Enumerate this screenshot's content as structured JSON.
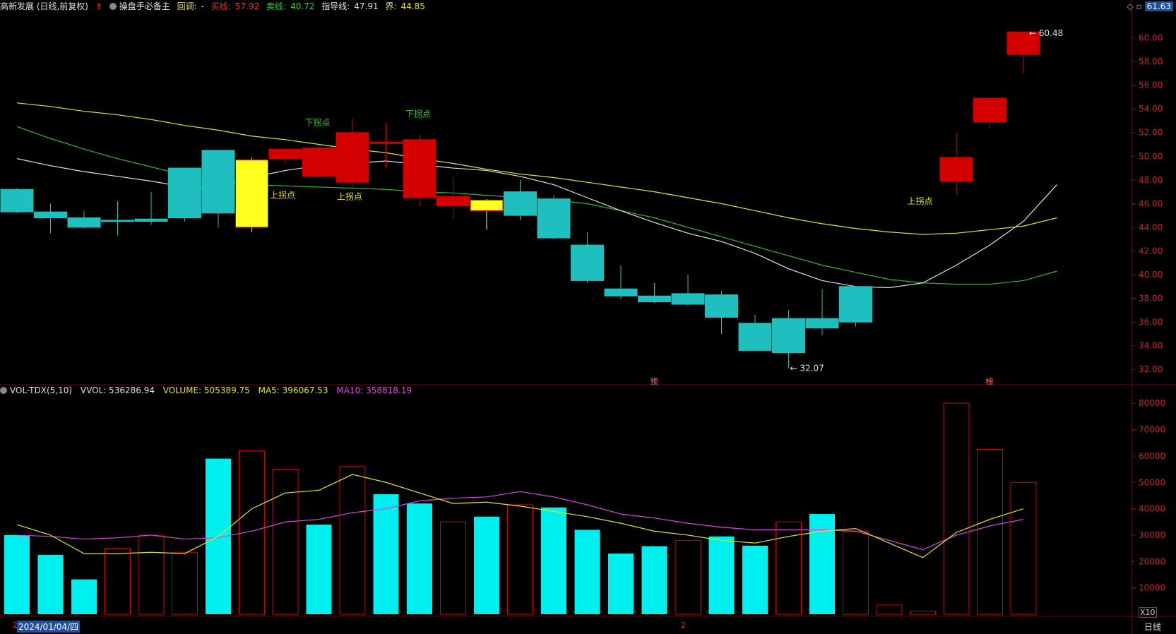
{
  "header": {
    "title": "高新发展 (日线,前复权)",
    "indicator_name": "操盘手必备主",
    "pullback_label": "回调:",
    "pullback_value": "-",
    "buy_label": "买线:",
    "buy_value": "57.92",
    "sell_label": "卖线:",
    "sell_value": "40.72",
    "guide_label": "指导线:",
    "guide_value": "47.91",
    "bound_label": "界:",
    "bound_value": "44.85",
    "current_price": "61.63"
  },
  "volume_header": {
    "name": "VOL-TDX(5,10)",
    "vvol": "VVOL: 536286.94",
    "volume": "VOLUME: 505389.75",
    "ma5": "MA5: 396067.53",
    "ma10": "MA10: 358818.19"
  },
  "footer": {
    "date": "2024/01/04/四",
    "period": "日线",
    "multiplier": "X10",
    "month_mark_1": "2",
    "month_mark_2": "2"
  },
  "colors": {
    "up": "#d40000",
    "down": "#1fbfbf",
    "ma_white": "#e0e0e0",
    "ma_yellow": "#e6e600",
    "ma_green": "#22bb22",
    "vol_ma5": "#e6e600",
    "vol_ma10": "#e040e0",
    "grid": "#7a0000"
  },
  "chart_data": [
    {
      "type": "candlestick",
      "ylim": [
        31,
        62
      ],
      "yticks": [
        32,
        34,
        36,
        38,
        40,
        42,
        44,
        46,
        48,
        50,
        52,
        54,
        56,
        58,
        60
      ],
      "ytick_labels": [
        "32.00",
        "34.00",
        "36.00",
        "38.00",
        "40.00",
        "42.00",
        "44.00",
        "46.00",
        "48.00",
        "50.00",
        "52.00",
        "54.00",
        "56.00",
        "58.00",
        "60.00"
      ],
      "candles": [
        {
          "o": 47.2,
          "h": 47.3,
          "l": 45.2,
          "c": 45.3,
          "color": "down"
        },
        {
          "o": 45.3,
          "h": 46.0,
          "l": 43.5,
          "c": 44.8,
          "color": "down"
        },
        {
          "o": 44.8,
          "h": 45.4,
          "l": 43.9,
          "c": 44.0,
          "color": "down"
        },
        {
          "o": 44.6,
          "h": 46.2,
          "l": 43.3,
          "c": 44.5,
          "color": "down"
        },
        {
          "o": 44.7,
          "h": 47.0,
          "l": 44.2,
          "c": 44.5,
          "color": "down"
        },
        {
          "o": 49.0,
          "h": 49.0,
          "l": 44.5,
          "c": 44.8,
          "color": "down"
        },
        {
          "o": 50.5,
          "h": 50.5,
          "l": 44.0,
          "c": 45.2,
          "color": "down"
        },
        {
          "o": 44.0,
          "h": 49.9,
          "l": 43.6,
          "c": 49.7,
          "color": "yellow"
        },
        {
          "o": 49.8,
          "h": 50.7,
          "l": 49.4,
          "c": 50.6,
          "color": "up"
        },
        {
          "o": 48.3,
          "h": 50.8,
          "l": 48.2,
          "c": 50.7,
          "color": "up"
        },
        {
          "o": 47.8,
          "h": 53.2,
          "l": 47.3,
          "c": 52.0,
          "color": "up"
        },
        {
          "o": 51.2,
          "h": 52.8,
          "l": 49.0,
          "c": 51.2,
          "color": "up"
        },
        {
          "o": 46.5,
          "h": 51.8,
          "l": 45.8,
          "c": 51.4,
          "color": "up"
        },
        {
          "o": 45.8,
          "h": 48.2,
          "l": 44.7,
          "c": 46.6,
          "color": "up"
        },
        {
          "o": 46.3,
          "h": 46.4,
          "l": 43.8,
          "c": 45.4,
          "color": "yellow"
        },
        {
          "o": 47.0,
          "h": 48.0,
          "l": 44.6,
          "c": 45.0,
          "color": "down"
        },
        {
          "o": 46.4,
          "h": 46.7,
          "l": 43.0,
          "c": 43.1,
          "color": "down"
        },
        {
          "o": 42.5,
          "h": 43.6,
          "l": 39.3,
          "c": 39.5,
          "color": "down"
        },
        {
          "o": 38.8,
          "h": 40.8,
          "l": 37.9,
          "c": 38.2,
          "color": "down"
        },
        {
          "o": 38.2,
          "h": 39.3,
          "l": 37.6,
          "c": 37.7,
          "color": "down"
        },
        {
          "o": 38.4,
          "h": 40.0,
          "l": 37.4,
          "c": 37.5,
          "color": "down"
        },
        {
          "o": 38.3,
          "h": 38.6,
          "l": 35.0,
          "c": 36.4,
          "color": "down"
        },
        {
          "o": 35.9,
          "h": 36.6,
          "l": 33.8,
          "c": 33.6,
          "color": "down"
        },
        {
          "o": 36.3,
          "h": 37.0,
          "l": 32.1,
          "c": 33.4,
          "color": "down"
        },
        {
          "o": 36.3,
          "h": 38.8,
          "l": 34.9,
          "c": 35.5,
          "color": "down"
        },
        {
          "o": 39.0,
          "h": 39.0,
          "l": 35.6,
          "c": 36.0,
          "color": "down"
        },
        {
          "o": null,
          "h": null,
          "l": null,
          "c": null,
          "color": "none"
        },
        {
          "o": null,
          "h": null,
          "l": null,
          "c": null,
          "color": "none"
        },
        {
          "o": 47.9,
          "h": 52.0,
          "l": 46.8,
          "c": 49.9,
          "color": "up"
        },
        {
          "o": 52.9,
          "h": 54.3,
          "l": 52.3,
          "c": 54.9,
          "color": "up"
        },
        {
          "o": 58.6,
          "h": 60.4,
          "l": 57.0,
          "c": 60.5,
          "color": "up"
        }
      ],
      "ma_white": [
        49.8,
        49.2,
        48.7,
        48.3,
        47.9,
        47.4,
        47.3,
        48.2,
        48.8,
        49.2,
        49.4,
        49.6,
        49.3,
        49.0,
        48.8,
        48.3,
        47.6,
        46.5,
        45.4,
        44.4,
        43.5,
        42.8,
        41.8,
        40.5,
        39.5,
        39.0,
        38.9,
        39.3,
        40.8,
        42.5,
        44.5,
        47.6
      ],
      "ma_yellow": [
        54.5,
        54.2,
        53.8,
        53.5,
        53.1,
        52.6,
        52.2,
        51.7,
        51.4,
        51.0,
        50.6,
        50.3,
        49.8,
        49.4,
        48.9,
        48.5,
        48.2,
        47.8,
        47.4,
        47.0,
        46.5,
        46.0,
        45.4,
        44.8,
        44.3,
        43.9,
        43.6,
        43.4,
        43.5,
        43.8,
        44.1,
        44.8
      ],
      "ma_green": [
        52.5,
        51.5,
        50.6,
        49.8,
        49.1,
        48.4,
        47.9,
        47.6,
        47.5,
        47.4,
        47.3,
        47.2,
        47.0,
        46.9,
        46.7,
        46.5,
        46.3,
        46.0,
        45.4,
        44.8,
        44.0,
        43.2,
        42.4,
        41.6,
        40.8,
        40.2,
        39.6,
        39.3,
        39.2,
        39.2,
        39.5,
        40.3
      ],
      "annotations": {
        "high_label": "60.48",
        "low_label": "32.07",
        "signal_up": "上拐点",
        "signal_down": "下拐点",
        "marker_1": "预",
        "marker_2": "榜"
      }
    },
    {
      "type": "bar",
      "ylim": [
        0,
        83000
      ],
      "yticks": [
        10000,
        20000,
        30000,
        40000,
        50000,
        60000,
        70000,
        80000
      ],
      "ytick_labels": [
        "10000",
        "20000",
        "30000",
        "40000",
        "50000",
        "60000",
        "70000",
        "80000"
      ],
      "values": [
        30000,
        22500,
        13200,
        25000,
        30000,
        23500,
        59000,
        62000,
        55000,
        34000,
        56000,
        45500,
        42000,
        35000,
        37000,
        41500,
        40500,
        32000,
        23000,
        25800,
        28000,
        29500,
        26000,
        35000,
        38000,
        31500,
        3500,
        1200,
        80000,
        62500,
        50000
      ],
      "colors": [
        "down",
        "down",
        "down",
        "up",
        "up",
        "up",
        "down",
        "up",
        "up",
        "down",
        "up",
        "down",
        "down",
        "up",
        "down",
        "up",
        "down",
        "down",
        "down",
        "down",
        "up",
        "down",
        "down",
        "up",
        "down",
        "up",
        "up",
        "up",
        "up",
        "up",
        "up"
      ],
      "ma5": [
        34000,
        30000,
        23000,
        23000,
        23500,
        23000,
        29500,
        40000,
        46000,
        47000,
        53000,
        50000,
        46000,
        42000,
        42500,
        41000,
        39000,
        37000,
        34500,
        31500,
        30000,
        28000,
        27000,
        29500,
        31500,
        32500,
        27000,
        21500,
        31000,
        36000,
        40000
      ],
      "ma10": [
        30000,
        29500,
        28500,
        29000,
        30000,
        28500,
        29000,
        31500,
        35000,
        36000,
        38500,
        40000,
        43000,
        44000,
        44500,
        46500,
        44500,
        41500,
        38000,
        36500,
        34500,
        33000,
        32000,
        32000,
        32000,
        31500,
        28000,
        24500,
        30000,
        33500,
        36000
      ]
    }
  ]
}
